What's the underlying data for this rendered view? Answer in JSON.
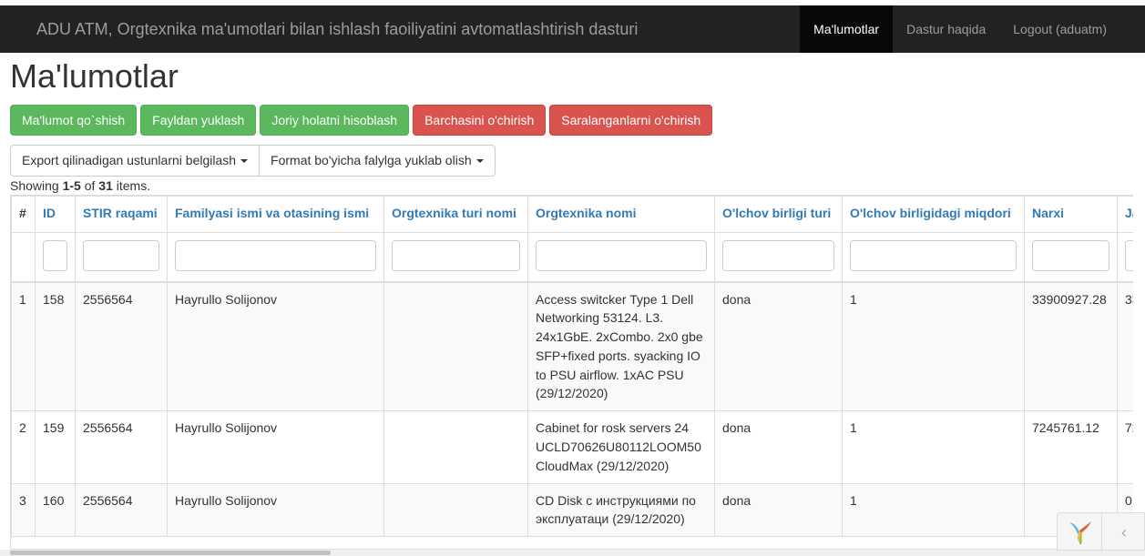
{
  "navbar": {
    "brand": "ADU ATM, Orgtexnika ma'umotlari bilan ishlash faoiliyatini avtomatlashtirish dasturi",
    "items": [
      {
        "label": "Ma'lumotlar"
      },
      {
        "label": "Dastur haqida"
      },
      {
        "label": "Logout (aduatm)"
      }
    ]
  },
  "page": {
    "title": "Ma'lumotlar"
  },
  "actions": [
    {
      "label": "Ma'lumot qo`shish"
    },
    {
      "label": "Fayldan yuklash"
    },
    {
      "label": "Joriy holatni hisoblash"
    },
    {
      "label": "Barchasini o'chirish"
    },
    {
      "label": "Saralanganlarni o'chirish"
    }
  ],
  "export": {
    "columns_label": "Export qilinadigan ustunlarni belgilash",
    "format_label": "Format bo'yicha falylga yuklab olish"
  },
  "summary": {
    "prefix": "Showing ",
    "range": "1-5",
    "of": " of ",
    "total": "31",
    "suffix": " items."
  },
  "table": {
    "headers": [
      "#",
      "ID",
      "STIR raqami",
      "Familyasi ismi va otasining ismi",
      "Orgtexnika turi nomi",
      "Orgtexnika nomi",
      "O'lchov birligi turi",
      "O'lchov birligidagi miqdori",
      "Narxi",
      "Ja"
    ],
    "rows": [
      {
        "num": "1",
        "id": "158",
        "stir": "2556564",
        "fio": "Hayrullo Solijonov",
        "type": "",
        "name": "Access switcker Type 1 Dell Networking 53124. L3. 24x1GbE. 2xCombo. 2x0 gbe SFP+fixed ports. syacking IO to PSU airflow. 1xAC PSU (29/12/2020)",
        "unit": "dona",
        "qty": "1",
        "price": "33900927.28",
        "extra": "33"
      },
      {
        "num": "2",
        "id": "159",
        "stir": "2556564",
        "fio": "Hayrullo Solijonov",
        "type": "",
        "name": "Cabinet for rosk servers 24 UCLD70626U80112LOOM50 CloudMax (29/12/2020)",
        "unit": "dona",
        "qty": "1",
        "price": "7245761.12",
        "extra": "72"
      },
      {
        "num": "3",
        "id": "160",
        "stir": "2556564",
        "fio": "Hayrullo Solijonov",
        "type": "",
        "name": "CD Disk с инструкциями по эксплуатаци (29/12/2020)",
        "unit": "dona",
        "qty": "1",
        "price": "",
        "extra": "0."
      }
    ]
  },
  "debug_toolbar": {
    "collapse_glyph": "‹"
  }
}
